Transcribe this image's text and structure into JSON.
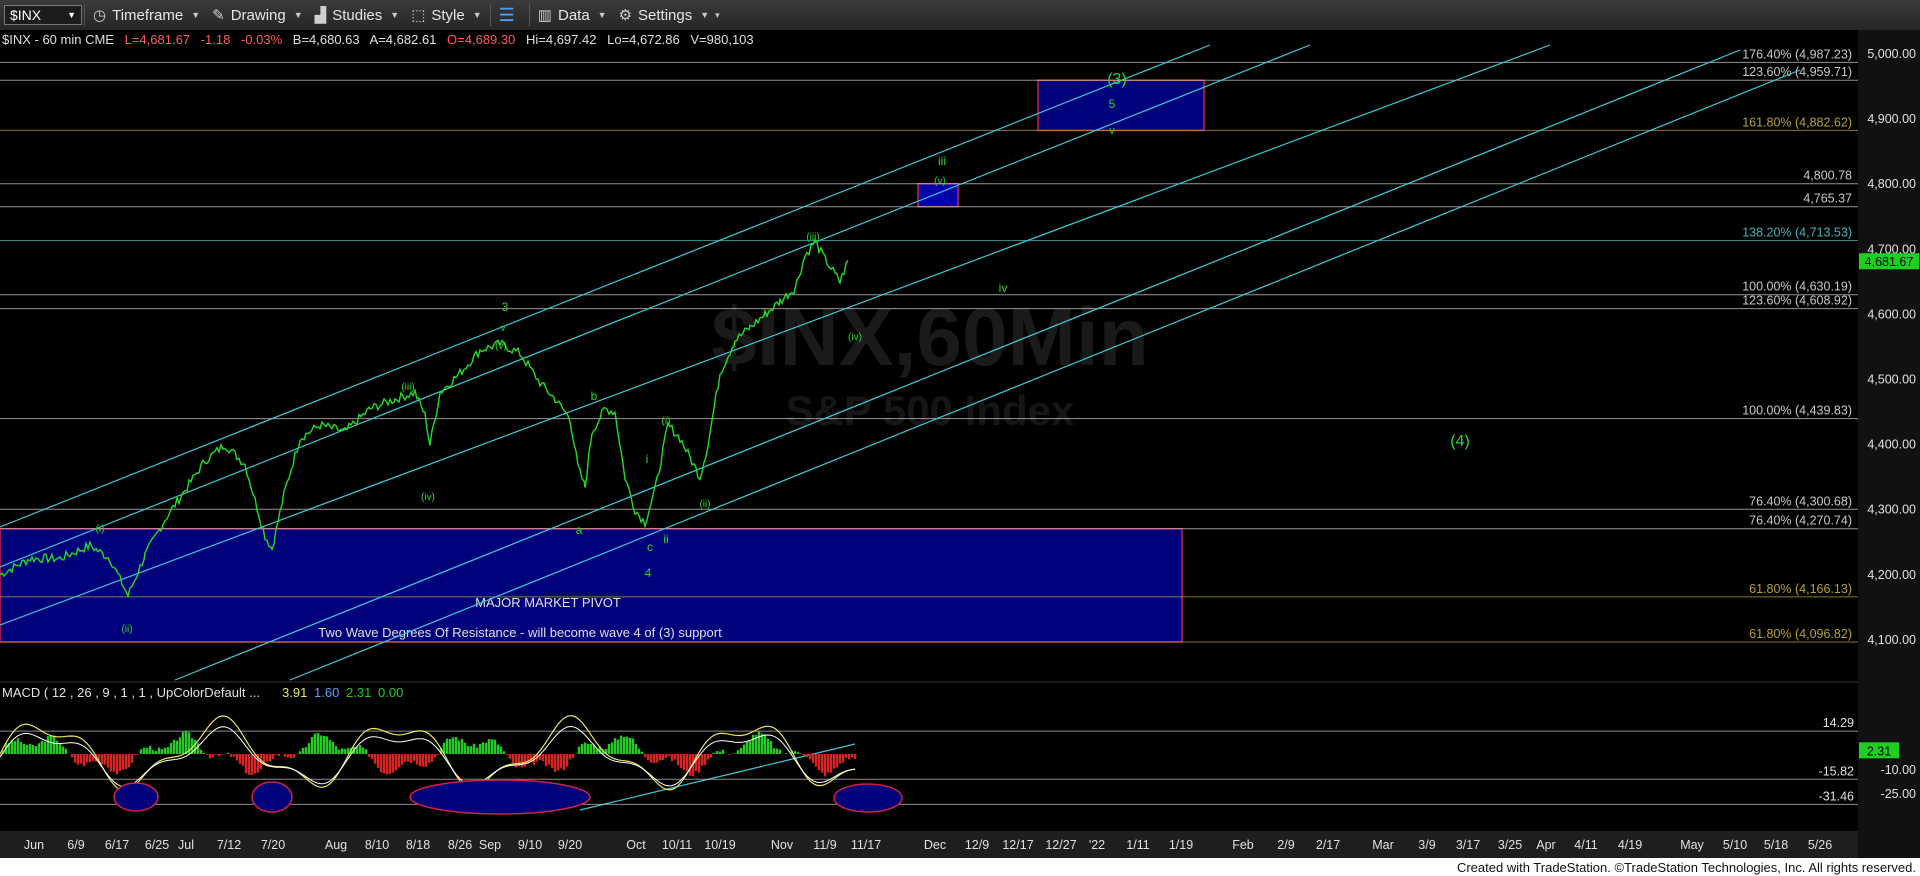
{
  "toolbar": {
    "symbol": "$INX",
    "timeframe_label": "Timeframe",
    "drawing_label": "Drawing",
    "studies_label": "Studies",
    "style_label": "Style",
    "data_label": "Data",
    "settings_label": "Settings"
  },
  "quote": {
    "symbol_line": "$INX - 60 min  CME",
    "last": "L=4,681.67",
    "change": "-1.18",
    "change_pct": "-0.03%",
    "bid": "B=4,680.63",
    "ask": "A=4,682.61",
    "open": "O=4,689.30",
    "high": "Hi=4,697.42",
    "low": "Lo=4,672.86",
    "volume": "V=980,103"
  },
  "watermark": {
    "title": "$INX,60Min",
    "subtitle": "S&P 500 Index"
  },
  "price_axis": {
    "ticks": [
      "5,000.00",
      "4,900.00",
      "4,800.00",
      "4,700.00",
      "4,600.00",
      "4,500.00",
      "4,400.00",
      "4,300.00",
      "4,200.00",
      "4,100.00"
    ],
    "tick_values": [
      5000,
      4900,
      4800,
      4700,
      4600,
      4500,
      4400,
      4300,
      4200,
      4100
    ],
    "last_price_badge": "4,681.67"
  },
  "fib_levels": [
    {
      "label": "176.40% (4,987.23)",
      "value": 4987.23,
      "color": "#c8c8c8"
    },
    {
      "label": "123.60% (4,959.71)",
      "value": 4959.71,
      "color": "#c8c8c8"
    },
    {
      "label": "161.80% (4,882.62)",
      "value": 4882.62,
      "color": "#b5a13a"
    },
    {
      "label": "4,800.78",
      "value": 4800.78,
      "color": "#c8c8c8"
    },
    {
      "label": "4,765.37",
      "value": 4765.37,
      "color": "#c8c8c8"
    },
    {
      "label": "138.20% (4,713.53)",
      "value": 4713.53,
      "color": "#3fb5b5"
    },
    {
      "label": "100.00% (4,630.19)",
      "value": 4630.19,
      "color": "#c8c8c8"
    },
    {
      "label": "123.60% (4,608.92)",
      "value": 4608.92,
      "color": "#c8c8c8"
    },
    {
      "label": "100.00% (4,439.83)",
      "value": 4439.83,
      "color": "#c8c8c8"
    },
    {
      "label": "76.40% (4,300.68)",
      "value": 4300.68,
      "color": "#c8c8c8"
    },
    {
      "label": "76.40% (4,270.74)",
      "value": 4270.74,
      "color": "#c8c8c8"
    },
    {
      "label": "61.80% (4,166.13)",
      "value": 4166.13,
      "color": "#b5a13a"
    },
    {
      "label": "61.80% (4,096.82)",
      "value": 4096.82,
      "color": "#b5a13a"
    }
  ],
  "zones": {
    "major_pivot_label": "MAJOR MARKET PIVOT",
    "resistance_label": "Two Wave Degrees Of Resistance - will become wave 4 of (3) support"
  },
  "wave_labels": {
    "w3_major": "(3)",
    "w4_major": "(4)",
    "w5": "5",
    "wv_target": "v",
    "wiii": "iii",
    "wv_small": "(v)",
    "wiv": "iv",
    "wiii_paren": "(iii)",
    "wiv_paren": "(iv)",
    "w3": "3",
    "wv_3": "v",
    "wv_paren2": "(v)",
    "wiii_paren2": "(iii)",
    "wiv_paren2": "(iv)",
    "wb": "b",
    "wa": "a",
    "wc": "c",
    "w4": "4",
    "wi_paren": "(i)",
    "wi": "i",
    "wii": "ii",
    "wii_paren": "(ii)",
    "wi_paren_left": "(i)",
    "wii_paren_left": "(ii)"
  },
  "macd": {
    "label": "MACD ( 12 , 26 , 9 , 1 , 1 , UpColorDefault ...",
    "v1": "3.91",
    "v2": "1.60",
    "v3": "2.31",
    "v4": "0.00",
    "levels": [
      {
        "label": "14.29",
        "value": 14.29
      },
      {
        "label": "-15.82",
        "value": -15.82
      },
      {
        "label": "-31.46",
        "value": -31.46
      }
    ],
    "axis_ticks": [
      "-10.00",
      "-25.00"
    ],
    "axis_tick_values": [
      -10,
      -25
    ],
    "badge": "2.31"
  },
  "time_axis": [
    "Jun",
    "6/9",
    "6/17",
    "6/25",
    "Jul",
    "7/12",
    "7/20",
    "Aug",
    "8/10",
    "8/18",
    "8/26",
    "Sep",
    "9/10",
    "9/20",
    "Oct",
    "10/11",
    "10/19",
    "Nov",
    "11/9",
    "11/17",
    "Dec",
    "12/9",
    "12/17",
    "12/27",
    "'22",
    "1/11",
    "1/19",
    "Feb",
    "2/9",
    "2/17",
    "Mar",
    "3/9",
    "3/17",
    "3/25",
    "Apr",
    "4/11",
    "4/19",
    "May",
    "5/10",
    "5/18",
    "5/26"
  ],
  "colors": {
    "price": "#22dd22",
    "channel": "#3fc8d8",
    "zone_fill": "#00007a",
    "zone_border": "#cc2244",
    "macd_line": "#e8e85a",
    "signal_line": "#ffffff",
    "hist_up": "#22cc22",
    "hist_down": "#dd2222"
  },
  "icons": [
    "dropdown-caret-icon",
    "timeframe-icon",
    "drawing-icon",
    "studies-icon",
    "style-icon",
    "layout-icon",
    "data-icon",
    "gear-icon"
  ],
  "footer": "Created with TradeStation. ©TradeStation Technologies, Inc. All rights reserved."
}
